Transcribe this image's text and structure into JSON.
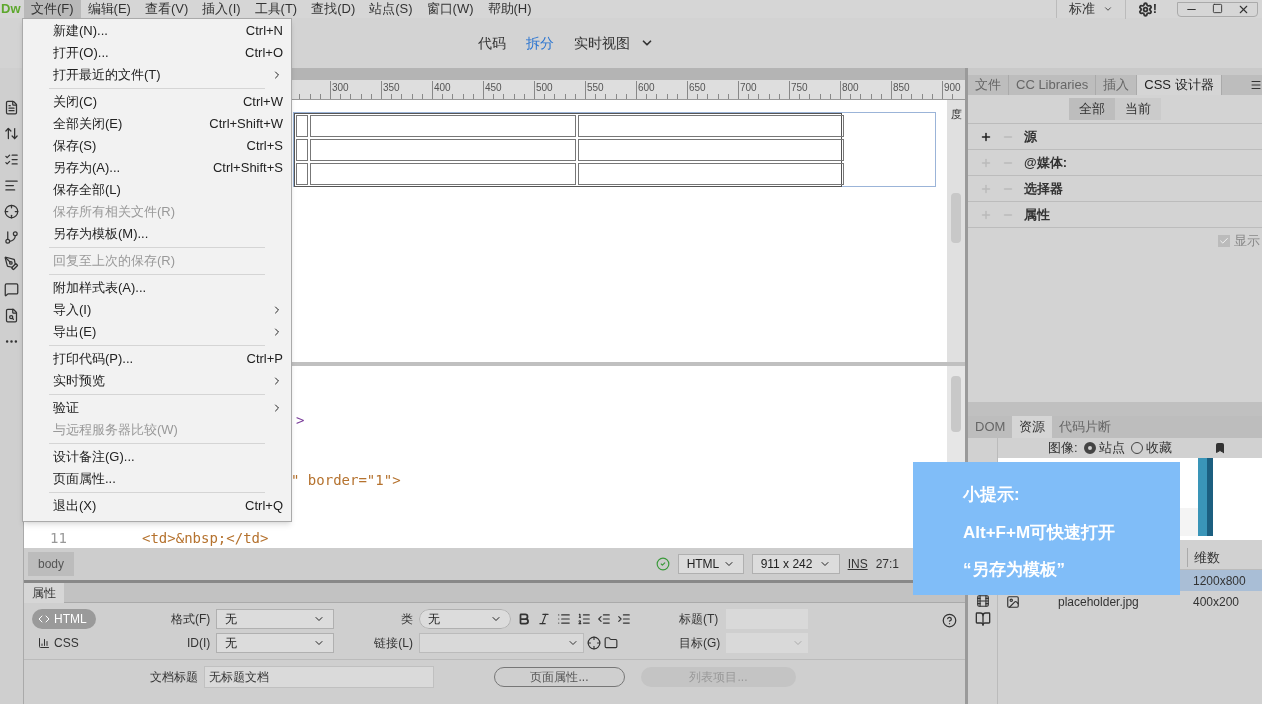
{
  "app": {
    "logo": "Dw",
    "menubar": [
      {
        "label": "文件(F)",
        "selected": true
      },
      {
        "label": "编辑(E)",
        "selected": false
      },
      {
        "label": "查看(V)",
        "selected": false
      },
      {
        "label": "插入(I)",
        "selected": false
      },
      {
        "label": "工具(T)",
        "selected": false
      },
      {
        "label": "查找(D)",
        "selected": false
      },
      {
        "label": "站点(S)",
        "selected": false
      },
      {
        "label": "窗口(W)",
        "selected": false
      },
      {
        "label": "帮助(H)",
        "selected": false
      }
    ],
    "workspace": "标准",
    "alert": "!"
  },
  "file_menu": [
    {
      "kind": "item",
      "label": "新建(N)...",
      "shortcut": "Ctrl+N",
      "disabled": false
    },
    {
      "kind": "item",
      "label": "打开(O)...",
      "shortcut": "Ctrl+O",
      "disabled": false
    },
    {
      "kind": "submenu",
      "label": "打开最近的文件(T)",
      "disabled": false
    },
    {
      "kind": "separator"
    },
    {
      "kind": "item",
      "label": "关闭(C)",
      "shortcut": "Ctrl+W",
      "disabled": false
    },
    {
      "kind": "item",
      "label": "全部关闭(E)",
      "shortcut": "Ctrl+Shift+W",
      "disabled": false
    },
    {
      "kind": "item",
      "label": "保存(S)",
      "shortcut": "Ctrl+S",
      "disabled": false
    },
    {
      "kind": "item",
      "label": "另存为(A)...",
      "shortcut": "Ctrl+Shift+S",
      "disabled": false
    },
    {
      "kind": "item",
      "label": "保存全部(L)",
      "disabled": false
    },
    {
      "kind": "item",
      "label": "保存所有相关文件(R)",
      "disabled": true
    },
    {
      "kind": "item",
      "label": "另存为模板(M)...",
      "disabled": false
    },
    {
      "kind": "separator"
    },
    {
      "kind": "item",
      "label": "回复至上次的保存(R)",
      "disabled": true
    },
    {
      "kind": "separator"
    },
    {
      "kind": "item",
      "label": "附加样式表(A)...",
      "disabled": false
    },
    {
      "kind": "submenu",
      "label": "导入(I)",
      "disabled": false
    },
    {
      "kind": "submenu",
      "label": "导出(E)",
      "disabled": false
    },
    {
      "kind": "separator"
    },
    {
      "kind": "item",
      "label": "打印代码(P)...",
      "shortcut": "Ctrl+P",
      "disabled": false
    },
    {
      "kind": "submenu",
      "label": "实时预览",
      "disabled": false
    },
    {
      "kind": "separator"
    },
    {
      "kind": "submenu",
      "label": "验证",
      "disabled": false
    },
    {
      "kind": "item",
      "label": "与远程服务器比较(W)",
      "disabled": true
    },
    {
      "kind": "separator"
    },
    {
      "kind": "item",
      "label": "设计备注(G)...",
      "disabled": false
    },
    {
      "kind": "item",
      "label": "页面属性...",
      "disabled": false
    },
    {
      "kind": "separator"
    },
    {
      "kind": "item",
      "label": "退出(X)",
      "shortcut": "Ctrl+Q",
      "disabled": false
    }
  ],
  "view_switcher": [
    {
      "label": "代码",
      "selected": false
    },
    {
      "label": "拆分",
      "selected": true
    },
    {
      "label": "实时视图",
      "selected": false
    }
  ],
  "ruler": [
    "300",
    "350",
    "400",
    "450",
    "500",
    "550",
    "600",
    "650",
    "700",
    "750",
    "800",
    "850",
    "900"
  ],
  "design_side_text": "度",
  "code_view": {
    "fragment": ">",
    "lines": [
      {
        "code": "\" border=\"1\">"
      },
      {
        "number": "11",
        "code": "<td>&nbsp;</td>"
      }
    ]
  },
  "status_bar": {
    "tag": "body",
    "mode": "HTML",
    "size": "911 x 242",
    "insert": "INS",
    "position": "27:1"
  },
  "properties": {
    "tab": "属性",
    "modes": [
      {
        "label": "HTML",
        "selected": true
      },
      {
        "label": "CSS",
        "selected": false
      }
    ],
    "format_label": "格式(F)",
    "format": "无",
    "id_label": "ID(I)",
    "id": "无",
    "class_label": "类",
    "class": "无",
    "link_label": "链接(L)",
    "title_label": "标题(T)",
    "target_label": "目标(G)",
    "doc_title_label": "文档标题",
    "doc_title": "无标题文档",
    "page_props_button": "页面属性...",
    "list_item_button": {
      "label": "列表项目...",
      "disabled": true
    }
  },
  "css_panel": {
    "tabs": [
      {
        "label": "文件",
        "selected": false
      },
      {
        "label": "CC Libraries",
        "selected": false
      },
      {
        "label": "插入",
        "selected": false
      },
      {
        "label": "CSS 设计器",
        "selected": true
      }
    ],
    "scope": [
      {
        "label": "全部",
        "selected": true
      },
      {
        "label": "当前",
        "selected": false
      }
    ],
    "sections": [
      {
        "label": "源",
        "enabled": true
      },
      {
        "label": "@媒体:",
        "enabled": false
      },
      {
        "label": "选择器",
        "enabled": false
      },
      {
        "label": "属性",
        "enabled": false
      }
    ],
    "show_set": {
      "label": "显示",
      "checked": true
    }
  },
  "assets_panel": {
    "tabs": [
      {
        "label": "DOM",
        "selected": false
      },
      {
        "label": "资源",
        "selected": true
      },
      {
        "label": "代码片断",
        "selected": false
      }
    ],
    "images_label": "图像:",
    "sources": [
      {
        "label": "站点",
        "selected": true
      },
      {
        "label": "收藏",
        "selected": false
      }
    ],
    "column": "维数",
    "rows": [
      {
        "size": "1200x800",
        "selected": true
      },
      {
        "name": "placeholder.jpg",
        "size": "400x200",
        "selected": false
      }
    ]
  },
  "tip": {
    "title": "小提示:",
    "lines": [
      "Alt+F+M可快速打开",
      "“另存为模板”"
    ]
  }
}
